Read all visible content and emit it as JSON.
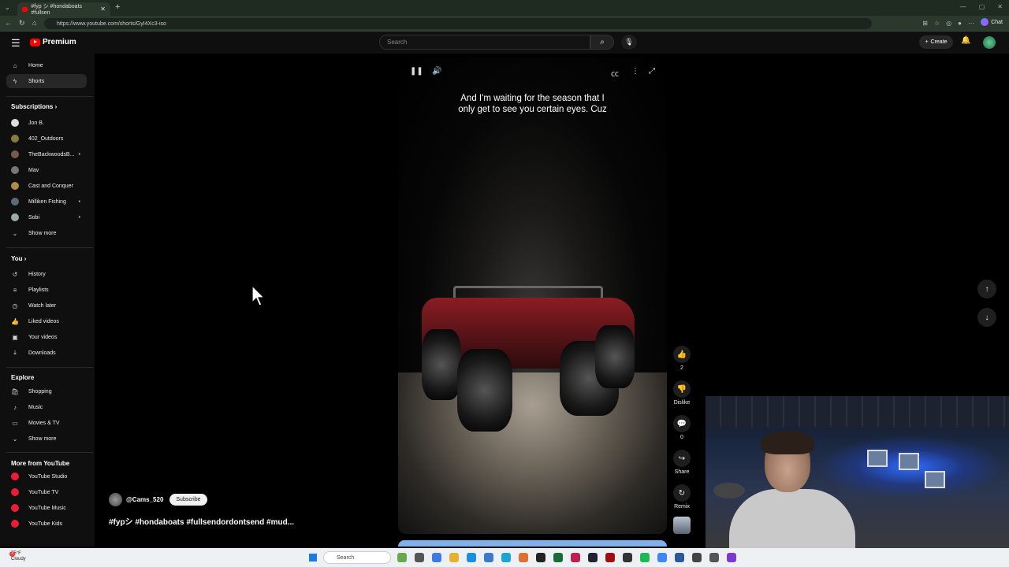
{
  "browser": {
    "tab_title": "#fyp シ #hondaboats #fullsen",
    "url": "https://www.youtube.com/shorts/GyI4Xc3-iso",
    "chat_label": "Chat"
  },
  "header": {
    "logo_text": "Premium",
    "search_placeholder": "Search",
    "create_label": "Create"
  },
  "sidebar": {
    "main": [
      {
        "label": "Home",
        "icon": "home-icon"
      },
      {
        "label": "Shorts",
        "icon": "shorts-icon"
      }
    ],
    "subscriptions_heading": "Subscriptions",
    "subscriptions": [
      {
        "label": "Jon B.",
        "dot": false
      },
      {
        "label": "402_Outdoors",
        "dot": false
      },
      {
        "label": "TheBackwoodsB...",
        "dot": true
      },
      {
        "label": "Mav",
        "dot": false
      },
      {
        "label": "Cast and Conquer",
        "dot": false
      },
      {
        "label": "Milliken Fishing",
        "dot": true
      },
      {
        "label": "Sobi",
        "dot": true
      }
    ],
    "show_more_1": "Show more",
    "you_heading": "You",
    "you_items": [
      {
        "label": "History",
        "icon": "history-icon"
      },
      {
        "label": "Playlists",
        "icon": "playlists-icon"
      },
      {
        "label": "Watch later",
        "icon": "watch-later-icon"
      },
      {
        "label": "Liked videos",
        "icon": "like-icon"
      },
      {
        "label": "Your videos",
        "icon": "your-videos-icon"
      },
      {
        "label": "Downloads",
        "icon": "download-icon"
      }
    ],
    "explore_heading": "Explore",
    "explore_items": [
      {
        "label": "Shopping",
        "icon": "shopping-icon"
      },
      {
        "label": "Music",
        "icon": "music-icon"
      },
      {
        "label": "Movies & TV",
        "icon": "movies-icon"
      }
    ],
    "show_more_2": "Show more",
    "more_heading": "More from YouTube",
    "more_items": [
      {
        "label": "YouTube Studio"
      },
      {
        "label": "YouTube TV"
      },
      {
        "label": "YouTube Music"
      },
      {
        "label": "YouTube Kids"
      }
    ]
  },
  "player": {
    "caption": "And I'm waiting for the season that I only get to see you certain eyes. Cuz"
  },
  "actions": {
    "likes": "2",
    "dislike_label": "Dislike",
    "comments": "0",
    "share_label": "Share",
    "remix_label": "Remix"
  },
  "video": {
    "channel": "@Cams_520",
    "subscribe_label": "Subscribe",
    "title": "#fypシ #hondaboats #fullsendordontsend #mud..."
  },
  "taskbar": {
    "temperature": "55°F",
    "weather": "Cloudy",
    "search_label": "Search"
  }
}
